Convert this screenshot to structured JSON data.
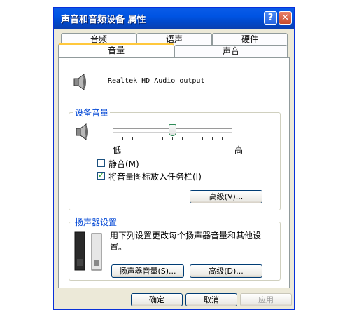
{
  "window": {
    "title": "声音和音频设备 属性",
    "help_glyph": "?",
    "close_glyph": "✕"
  },
  "tabs": {
    "row1": [
      "音频",
      "语声",
      "硬件"
    ],
    "row2": [
      "音量",
      "声音"
    ],
    "active": "音量"
  },
  "device": {
    "name": "Realtek HD Audio output"
  },
  "device_volume": {
    "label": "设备音量",
    "low": "低",
    "high": "高",
    "level": 0.5,
    "mute_label": "静音(M)",
    "mute_checked": false,
    "tray_label": "将音量图标放入任务栏(I)",
    "tray_checked": true,
    "advanced_button": "高级(V)..."
  },
  "speaker_settings": {
    "label": "扬声器设置",
    "description_line1": "用下列设置更改每个扬声器音量和其他设",
    "description_line2": "置。",
    "speaker_volume_button": "扬声器音量(S)...",
    "advanced_button": "高级(D)..."
  },
  "footer": {
    "ok": "确定",
    "cancel": "取消",
    "apply": "应用"
  },
  "colors": {
    "titlebar": "#0054e3",
    "group_label": "#0046d5",
    "window_bg": "#ece9d8"
  }
}
